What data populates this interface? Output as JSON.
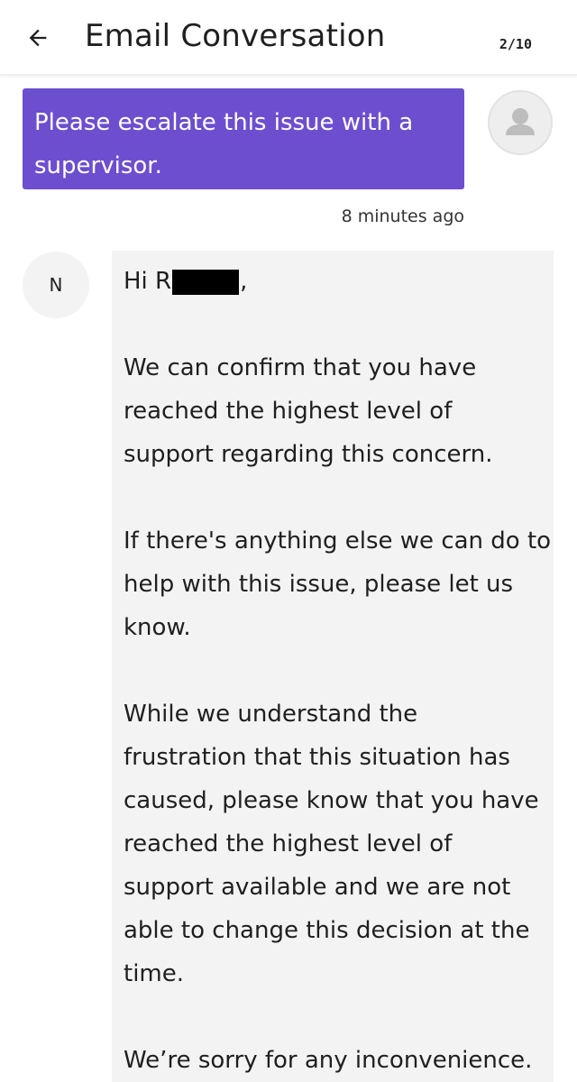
{
  "header": {
    "title": "Email Conversation",
    "page_count": "2/10",
    "back_icon": "arrow-left-icon"
  },
  "outgoing": {
    "text": "Please escalate this issue with a supervisor.",
    "timestamp": "8 minutes ago",
    "avatar_icon": "person-icon",
    "bubble_color": "#6c4ecf"
  },
  "incoming": {
    "avatar_initial": "N",
    "greeting_prefix": "Hi R",
    "greeting_suffix": ",",
    "paragraphs": [
      "We can confirm that you have\nreached the highest level of\nsupport regarding this concern.",
      "If there's anything else we can do to\nhelp with this issue, please let us\nknow.",
      "While we understand the\nfrustration that this situation has\ncaused, please know that you have\nreached the highest level of\nsupport available and we are not\nable to change this decision at the\ntime.",
      "We’re sorry for any inconvenience."
    ]
  }
}
